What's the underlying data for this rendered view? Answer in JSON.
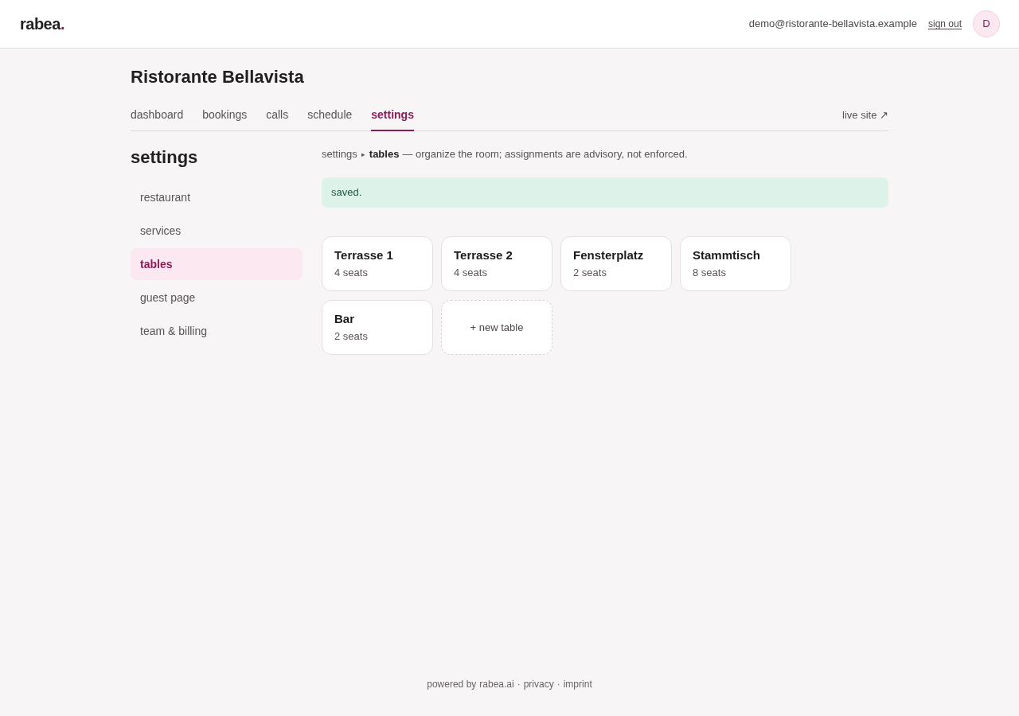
{
  "header": {
    "logo": {
      "text": "rabea",
      "dot": "."
    },
    "email": "demo@ristorante-bellavista.example",
    "sign_out": "sign out",
    "avatar": "D"
  },
  "page_title": "Ristorante Bellavista",
  "tabs": [
    {
      "label": "dashboard",
      "selected": false
    },
    {
      "label": "bookings",
      "selected": false
    },
    {
      "label": "calls",
      "selected": false
    },
    {
      "label": "schedule",
      "selected": false
    },
    {
      "label": "settings",
      "selected": true
    }
  ],
  "live_site_link": "live site ↗",
  "sidebar": {
    "title": "settings",
    "items": [
      {
        "label": "restaurant",
        "selected": false
      },
      {
        "label": "services",
        "selected": false
      },
      {
        "label": "tables",
        "selected": true
      },
      {
        "label": "guest page",
        "selected": false
      },
      {
        "label": "team & billing",
        "selected": false
      }
    ]
  },
  "breadcrumb": {
    "parent": "settings",
    "separator": "▸",
    "current": "tables",
    "description": "— organize the room; assignments are advisory, not enforced."
  },
  "notice": {
    "kind": "success",
    "text": "saved."
  },
  "tables": [
    {
      "name": "Terrasse 1",
      "seats": "4 seats"
    },
    {
      "name": "Terrasse 2",
      "seats": "4 seats"
    },
    {
      "name": "Fensterplatz",
      "seats": "2 seats"
    },
    {
      "name": "Stammtisch",
      "seats": "8 seats"
    },
    {
      "name": "Bar",
      "seats": "2 seats"
    }
  ],
  "new_table_button": "+ new table",
  "footer": [
    {
      "kind": "text",
      "label": "powered by"
    },
    {
      "kind": "link",
      "label": "rabea.ai"
    },
    {
      "kind": "separator",
      "label": "·"
    },
    {
      "kind": "link",
      "label": "privacy"
    },
    {
      "kind": "separator",
      "label": "·"
    },
    {
      "kind": "link",
      "label": "imprint"
    }
  ]
}
